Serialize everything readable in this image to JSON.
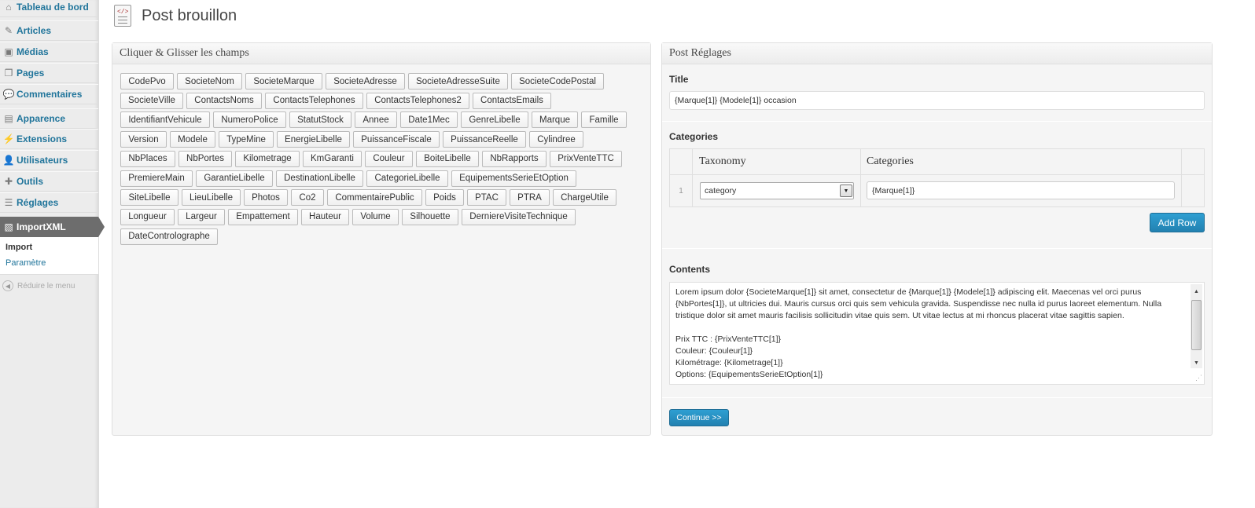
{
  "sidebar": {
    "items": [
      {
        "label": "Tableau de bord",
        "icon": "home-icon"
      },
      {
        "label": "Articles",
        "icon": "pin-icon"
      },
      {
        "label": "Médias",
        "icon": "media-icon"
      },
      {
        "label": "Pages",
        "icon": "pages-icon"
      },
      {
        "label": "Commentaires",
        "icon": "comment-icon"
      },
      {
        "label": "Apparence",
        "icon": "appearance-icon"
      },
      {
        "label": "Extensions",
        "icon": "plugin-icon"
      },
      {
        "label": "Utilisateurs",
        "icon": "users-icon"
      },
      {
        "label": "Outils",
        "icon": "tools-icon"
      },
      {
        "label": "Réglages",
        "icon": "settings-icon"
      },
      {
        "label": "ImportXML",
        "icon": "importxml-icon"
      }
    ],
    "submenu": {
      "current": "Import",
      "link": "Paramètre"
    },
    "collapse_label": "Réduire le menu"
  },
  "page": {
    "title": "Post brouillon"
  },
  "fields_panel": {
    "title": "Cliquer & Glisser les champs",
    "rows": [
      [
        "CodePvo",
        "SocieteNom",
        "SocieteMarque",
        "SocieteAdresse",
        "SocieteAdresseSuite",
        "SocieteCodePostal"
      ],
      [
        "SocieteVille",
        "ContactsNoms",
        "ContactsTelephones",
        "ContactsTelephones2",
        "ContactsEmails"
      ],
      [
        "IdentifiantVehicule",
        "NumeroPolice",
        "StatutStock",
        "Annee",
        "Date1Mec",
        "GenreLibelle",
        "Marque",
        "Famille"
      ],
      [
        "Version",
        "Modele",
        "TypeMine",
        "EnergieLibelle",
        "PuissanceFiscale",
        "PuissanceReelle",
        "Cylindree"
      ],
      [
        "NbPlaces",
        "NbPortes",
        "Kilometrage",
        "KmGaranti",
        "Couleur",
        "BoiteLibelle",
        "NbRapports",
        "PrixVenteTTC"
      ],
      [
        "PremiereMain",
        "GarantieLibelle",
        "DestinationLibelle",
        "CategorieLibelle",
        "EquipementsSerieEtOption"
      ],
      [
        "SiteLibelle",
        "LieuLibelle",
        "Photos",
        "Co2",
        "CommentairePublic",
        "Poids",
        "PTAC",
        "PTRA",
        "ChargeUtile"
      ],
      [
        "Longueur",
        "Largeur",
        "Empattement",
        "Hauteur",
        "Volume",
        "Silhouette",
        "DerniereVisiteTechnique"
      ],
      [
        "DateControlographe"
      ]
    ]
  },
  "settings_panel": {
    "title": "Post Réglages",
    "title_label": "Title",
    "title_value": "{Marque[1]} {Modele[1]} occasion",
    "categories_label": "Categories",
    "table": {
      "headers": [
        "Taxonomy",
        "Categories"
      ],
      "row": {
        "index": "1",
        "taxonomy": "category",
        "categories": "{Marque[1]}"
      }
    },
    "add_row_label": "Add Row",
    "contents_label": "Contents",
    "contents_value": "Lorem ipsum dolor {SocieteMarque[1]} sit amet, consectetur de {Marque[1]} {Modele[1]} adipiscing elit. Maecenas vel orci purus {NbPortes[1]}, ut ultricies dui. Mauris cursus orci quis sem vehicula gravida. Suspendisse nec nulla id purus laoreet elementum. Nulla tristique dolor sit amet mauris facilisis sollicitudin vitae quis sem. Ut vitae lectus at mi rhoncus placerat vitae sagittis sapien.\n\nPrix TTC : {PrixVenteTTC[1]}\nCouleur: {Couleur[1]}\nKilométrage: {Kilometrage[1]}\nOptions: {EquipementsSerieEtOption[1]}",
    "continue_label": "Continue >>"
  },
  "colors": {
    "accent": "#21759b",
    "button": "#2281b1",
    "active_menu": "#6d6d6d"
  }
}
